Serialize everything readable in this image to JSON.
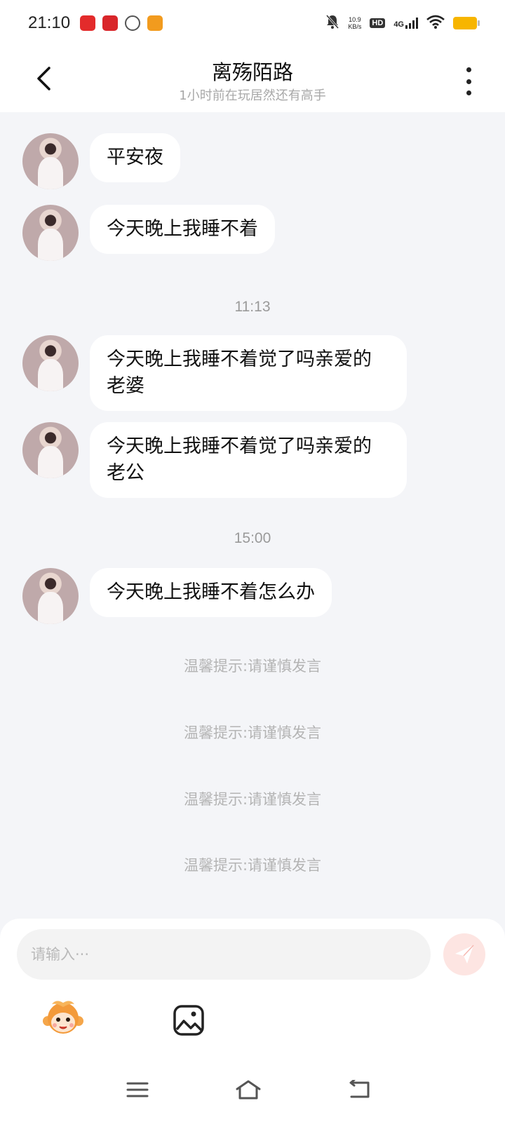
{
  "status_bar": {
    "time": "21:10",
    "net_speed_value": "10.9",
    "net_speed_unit": "KB/s",
    "hd": "HD",
    "network": "4G",
    "battery_color": "#f7b500"
  },
  "header": {
    "title": "离殇陌路",
    "subtitle": "1小时前在玩居然还有高手",
    "back_icon": "chevron-left-icon",
    "more_icon": "more-vertical-icon"
  },
  "messages": [
    {
      "text": "平安夜"
    },
    {
      "text": "今天晚上我睡不着"
    },
    {
      "text": "今天晚上我睡不着觉了吗亲爱的老婆"
    },
    {
      "text": "今天晚上我睡不着觉了吗亲爱的老公"
    },
    {
      "text": "今天晚上我睡不着怎么办"
    }
  ],
  "timestamps": [
    "11:13",
    "15:00"
  ],
  "tips": [
    "温馨提示:请谨慎发言",
    "温馨提示:请谨慎发言",
    "温馨提示:请谨慎发言",
    "温馨提示:请谨慎发言"
  ],
  "composer": {
    "placeholder": "请输入···",
    "send_icon": "send-icon",
    "emoji_icon": "emoji-monkey-icon",
    "image_icon": "image-icon"
  },
  "colors": {
    "background": "#f4f5f8",
    "bubble": "#ffffff",
    "send_button": "#fde5e2",
    "send_arrow": "#ffffff"
  },
  "navbar": {
    "menu_icon": "menu-icon",
    "home_icon": "home-icon",
    "back_icon": "return-icon"
  }
}
